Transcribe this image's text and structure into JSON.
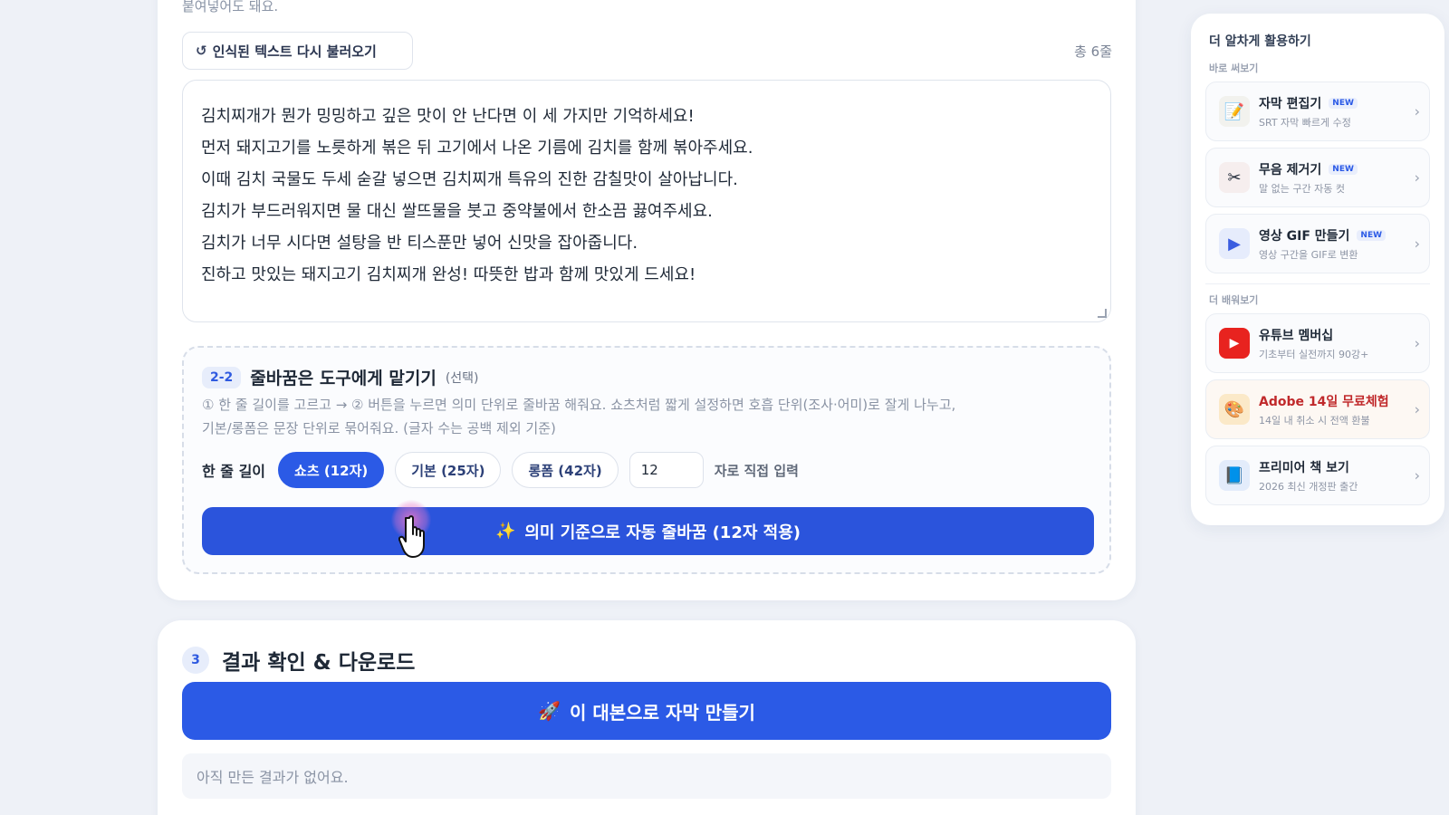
{
  "editor": {
    "top_text": "붙여넣어도 돼요.",
    "reload_label": "인식된 텍스트 다시 불러오기",
    "line_count": "총 6줄",
    "script_lines": [
      "김치찌개가 뭔가 밍밍하고 깊은 맛이 안 난다면 이 세 가지만 기억하세요!",
      "먼저 돼지고기를 노릇하게 볶은 뒤 고기에서 나온 기름에 김치를 함께 볶아주세요.",
      "이때 김치 국물도 두세 숟갈 넣으면 김치찌개 특유의 진한 감칠맛이 살아납니다.",
      "김치가 부드러워지면 물 대신 쌀뜨물을 붓고 중약불에서 한소끔 끓여주세요.",
      "김치가 너무 시다면 설탕을 반 티스푼만 넣어 신맛을 잡아줍니다.",
      "진하고 맛있는 돼지고기 김치찌개 완성! 따뜻한 밥과 함께 맛있게 드세요!"
    ]
  },
  "wrap": {
    "step": "2-2",
    "title": "줄바꿈은 도구에게 맡기기",
    "optional": "(선택)",
    "desc1": "① 한 줄 길이를 고르고 → ② 버튼을 누르면 의미 단위로 줄바꿈 해줘요. 쇼츠처럼 짧게 설정하면 호흡 단위(조사·어미)로 잘게 나누고,",
    "desc2": "기본/롱폼은 문장 단위로 묶어줘요. (글자 수는 공백 제외 기준)",
    "len_label": "한 줄 길이",
    "options": [
      "쇼츠 (12자)",
      "기본 (25자)",
      "롱폼 (42자)"
    ],
    "input_value": "12",
    "suffix": "자로 직접 입력",
    "button": "의미 기준으로 자동 줄바꿈 (12자 적용)"
  },
  "result": {
    "step": "3",
    "title": "결과 확인 & 다운로드",
    "make_button": "이 대본으로 자막 만들기",
    "empty": "아직 만든 결과가 없어요."
  },
  "sidebar": {
    "title": "더 알차게 활용하기",
    "section1": "바로 써보기",
    "section2": "더 배워보기",
    "new_badge": "NEW",
    "items": [
      {
        "name": "자막 편집기",
        "sub": "SRT 자막 빠르게 수정",
        "icon": "edit-icon"
      },
      {
        "name": "무음 제거기",
        "sub": "말 없는 구간 자동 컷",
        "icon": "scissors-icon"
      },
      {
        "name": "영상 GIF 만들기",
        "sub": "영상 구간을 GIF로 변환",
        "icon": "video-icon"
      },
      {
        "name": "유튜브 멤버십",
        "sub": "기초부터 실전까지 90강+",
        "icon": "youtube-icon"
      },
      {
        "name": "Adobe 14일 무료체험",
        "sub": "14일 내 취소 시 전액 환불",
        "icon": "palette-icon"
      },
      {
        "name": "프리미어 책 보기",
        "sub": "2026 최신 개정판 출간",
        "icon": "book-icon"
      }
    ]
  },
  "colors": {
    "primary": "#2b5ae6",
    "accent_red": "#c0292b",
    "background": "#eef1f7"
  }
}
